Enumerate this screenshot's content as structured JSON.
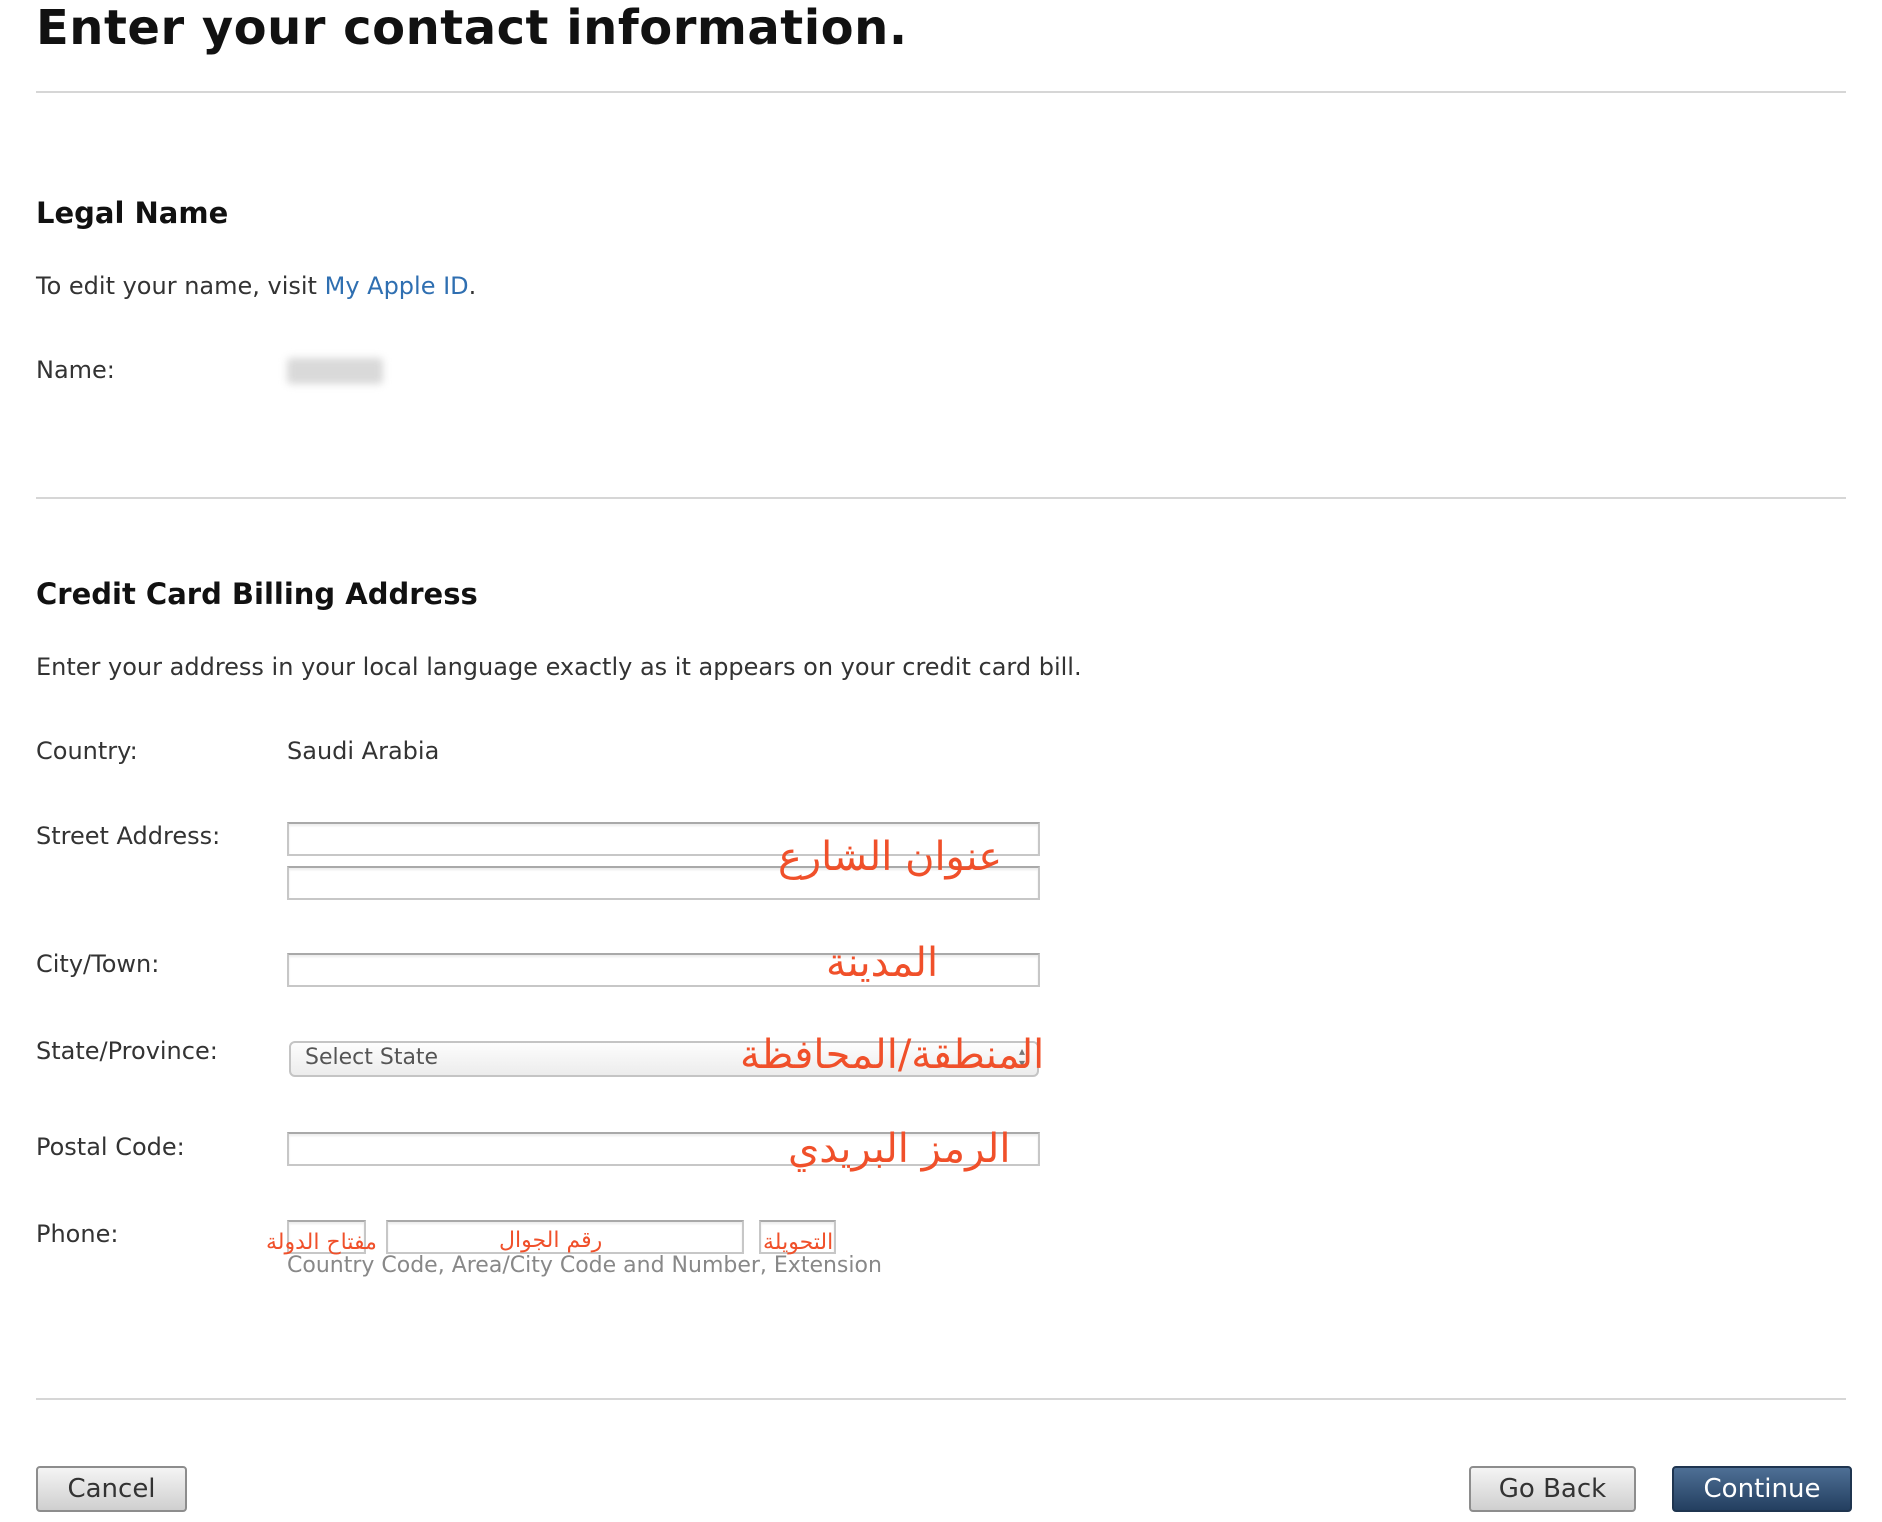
{
  "page": {
    "title": "Enter your contact information."
  },
  "legal_name": {
    "heading": "Legal Name",
    "instruction_prefix": "To edit your name, visit ",
    "instruction_link": "My Apple ID",
    "instruction_suffix": ".",
    "name_label": "Name:"
  },
  "billing": {
    "heading": "Credit Card Billing Address",
    "instruction": "Enter your address in your local language exactly as it appears on your credit card bill.",
    "country_label": "Country:",
    "country_value": "Saudi Arabia",
    "street_label": "Street Address:",
    "city_label": "City/Town:",
    "state_label": "State/Province:",
    "state_select": "Select State",
    "postal_label": "Postal Code:",
    "phone_label": "Phone:",
    "phone_hint": "Country Code, Area/City Code and Number, Extension"
  },
  "annotations": {
    "street": "عنوان الشارع",
    "city": "المدينة",
    "state": "المنطقة/المحافظة",
    "postal": "الرمز البريدي",
    "country_code": "مفتاح الدولة",
    "number": "رقم الجوال",
    "extension": "التحويلة",
    "color": "#f0502a"
  },
  "buttons": {
    "cancel": "Cancel",
    "go_back": "Go Back",
    "continue": "Continue"
  }
}
